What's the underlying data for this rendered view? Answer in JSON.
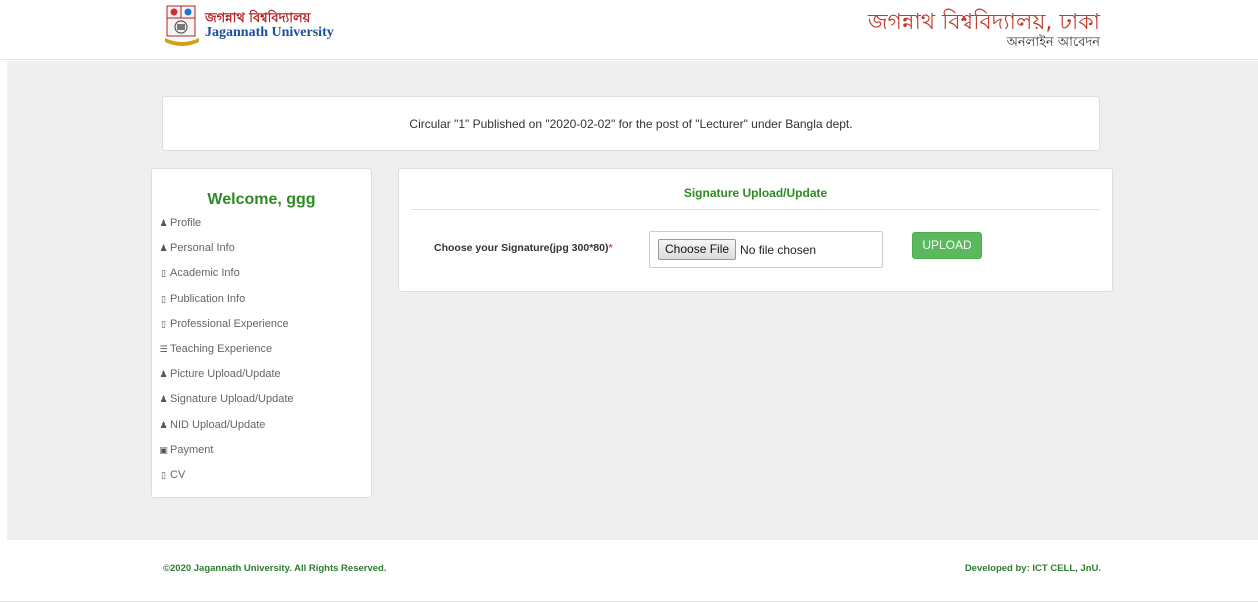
{
  "header": {
    "logo_bn": "জগন্নাথ বিশ্ববিদ্যালয়",
    "logo_en": "Jagannath University",
    "title_bn": "জগন্নাথ বিশ্ববিদ্যালয়, ঢাকা",
    "subtitle_bn": "অনলাইন আবেদন"
  },
  "circular": {
    "text": "Circular \"1\" Published on \"2020-02-02\" for the post of \"Lecturer\" under Bangla dept."
  },
  "sidebar": {
    "welcome": "Welcome, ggg",
    "items": [
      {
        "label": "Profile",
        "icon": "user-icon"
      },
      {
        "label": "Personal Info",
        "icon": "user-icon"
      },
      {
        "label": "Academic Info",
        "icon": "book-icon"
      },
      {
        "label": "Publication Info",
        "icon": "book-icon"
      },
      {
        "label": "Professional Experience",
        "icon": "book-icon"
      },
      {
        "label": "Teaching Experience",
        "icon": "list-icon"
      },
      {
        "label": "Picture Upload/Update",
        "icon": "user-icon"
      },
      {
        "label": "Signature Upload/Update",
        "icon": "user-icon"
      },
      {
        "label": "NID Upload/Update",
        "icon": "user-icon"
      },
      {
        "label": "Payment",
        "icon": "money-icon"
      },
      {
        "label": "CV",
        "icon": "book-icon"
      }
    ]
  },
  "content": {
    "title": "Signature Upload/Update",
    "field_label": "Choose your Signature(jpg 300*80)",
    "required_mark": "*",
    "file_button": "Choose File",
    "file_status": "No file chosen",
    "upload_button": "UPLOAD"
  },
  "footer": {
    "copyright": "©2020 Jagannath University. All Rights Reserved.",
    "developer": "Developed by: ICT CELL, JnU."
  },
  "colors": {
    "accent_green": "#2e8b24",
    "button_green": "#5cb85c",
    "title_red": "#c0392b"
  }
}
